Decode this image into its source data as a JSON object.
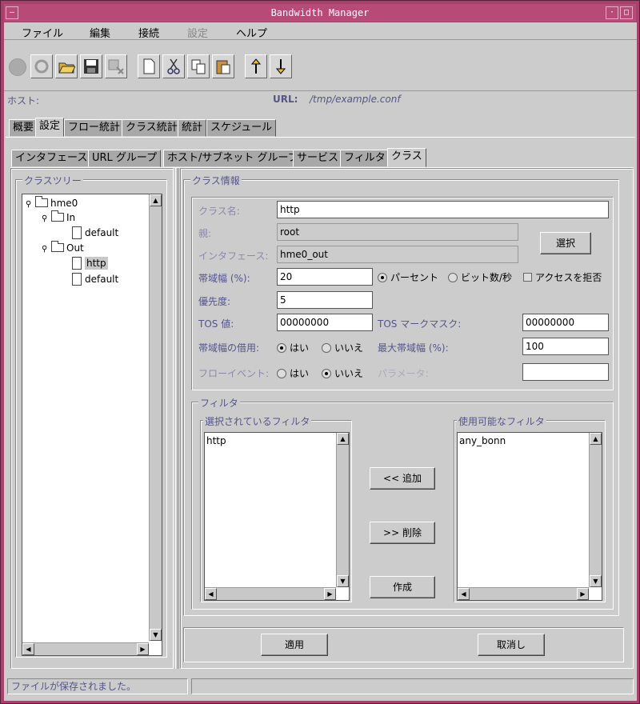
{
  "window": {
    "title": "Bandwidth Manager"
  },
  "menu": [
    "ファイル",
    "編集",
    "接続",
    "設定",
    "ヘルプ"
  ],
  "host": {
    "label": "ホスト:",
    "value": ""
  },
  "url": {
    "label": "URL:",
    "value": "/tmp/example.conf"
  },
  "main_tabs": [
    "概要",
    "設定",
    "フロー統計",
    "クラス統計",
    "統計",
    "スケジュール"
  ],
  "sub_tabs": [
    "インタフェース",
    "URL グループ",
    "ホスト/サブネット グループ",
    "サービス",
    "フィルタ",
    "クラス"
  ],
  "tree": {
    "title": "クラスツリー",
    "items": [
      "hme0",
      "In",
      "default",
      "Out",
      "http",
      "default"
    ]
  },
  "class_info": {
    "title": "クラス情報",
    "name_label": "クラス名:",
    "name_value": "http",
    "parent_label": "親:",
    "parent_value": "root",
    "interface_label": "インタフェース:",
    "interface_value": "hme0_out",
    "select_button": "選択",
    "bandwidth_label": "帯域幅 (%):",
    "bandwidth_value": "20",
    "percent_option": "パーセント",
    "bps_option": "ビット数/秒",
    "deny_access": "アクセスを拒否",
    "priority_label": "優先度:",
    "priority_value": "5",
    "tos_label": "TOS 値:",
    "tos_value": "00000000",
    "tos_mask_label": "TOS マークマスク:",
    "tos_mask_value": "00000000",
    "borrow_label": "帯域幅の借用:",
    "yes": "はい",
    "no": "いいえ",
    "max_bw_label": "最大帯域幅 (%):",
    "max_bw_value": "100",
    "flow_event_label": "フローイベント:",
    "param_label": "パラメータ:",
    "param_value": ""
  },
  "filter": {
    "title": "フィルタ",
    "selected_title": "選択されているフィルタ",
    "selected_items": [
      "http"
    ],
    "available_title": "使用可能なフィルタ",
    "available_items": [
      "any_bonn"
    ],
    "add_button": "<< 追加",
    "remove_button": ">> 削除",
    "create_button": "作成"
  },
  "buttons": {
    "apply": "適用",
    "cancel": "取消し"
  },
  "status": "ファイルが保存されました。"
}
